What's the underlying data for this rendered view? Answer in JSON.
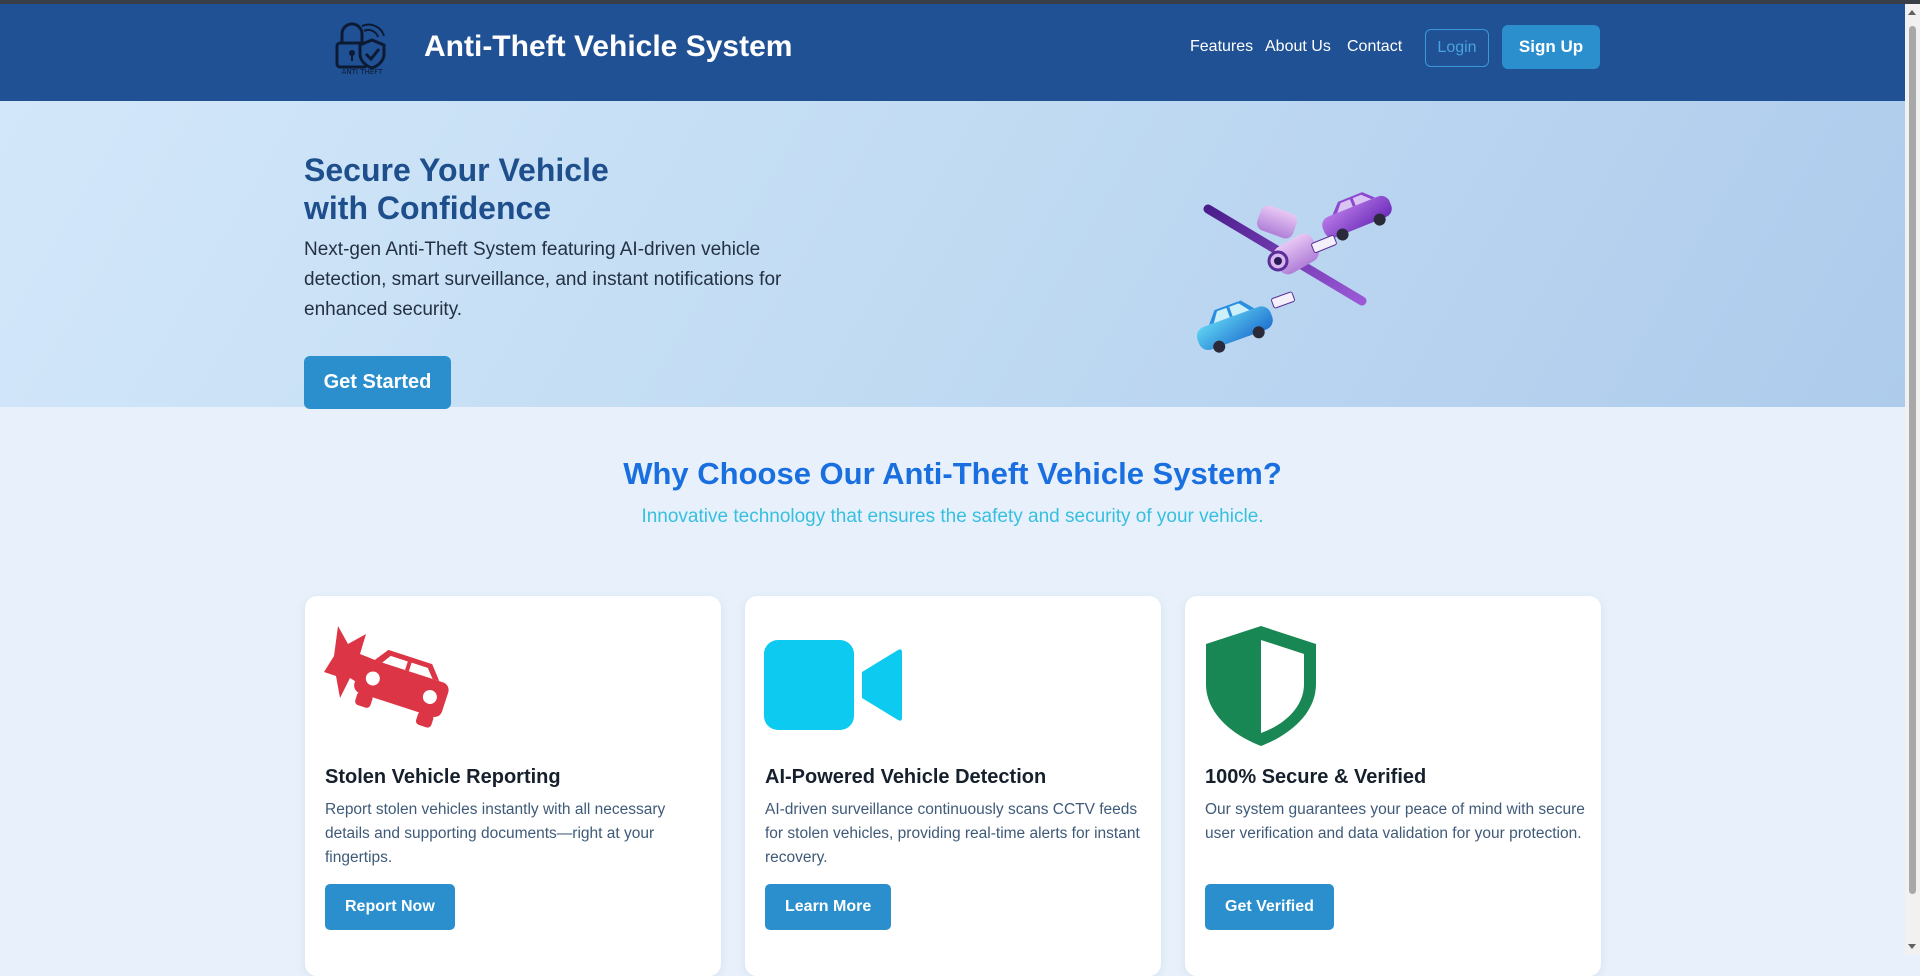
{
  "navbar": {
    "logo_icon": "lock-shield-icon",
    "logo_caption": "ANTI THEFT",
    "brand": "Anti-Theft Vehicle System",
    "links": [
      "Features",
      "About Us",
      "Contact"
    ],
    "login_label": "Login",
    "signup_label": "Sign Up"
  },
  "hero": {
    "title_line1": "Secure Your Vehicle",
    "title_line2": "with Confidence",
    "description": "Next-gen Anti-Theft System featuring AI-driven vehicle detection, smart surveillance, and instant notifications for enhanced security.",
    "cta_label": "Get Started",
    "illustration": "cctv-camera-with-cars-illustration"
  },
  "features": {
    "title": "Why Choose Our Anti-Theft Vehicle System?",
    "subtitle": "Innovative technology that ensures the safety and security of your vehicle.",
    "cards": [
      {
        "icon": "car-crash-icon",
        "icon_color": "#dc3545",
        "title": "Stolen Vehicle Reporting",
        "description": "Report stolen vehicles instantly with all necessary details and supporting documents—right at your fingertips.",
        "button": "Report Now"
      },
      {
        "icon": "video-camera-icon",
        "icon_color": "#0dcaf0",
        "title": "AI-Powered Vehicle Detection",
        "description": "AI-driven surveillance continuously scans CCTV feeds for stolen vehicles, providing real-time alerts for instant recovery.",
        "button": "Learn More"
      },
      {
        "icon": "shield-half-icon",
        "icon_color": "#198754",
        "title": "100% Secure & Verified",
        "description": "Our system guarantees your peace of mind with secure user verification and data validation for your protection.",
        "button": "Get Verified"
      }
    ]
  },
  "colors": {
    "navbar_bg": "#1f5194",
    "primary_button": "#2b8fce",
    "section_title": "#1a6fe0",
    "section_subtitle": "#37bfe0"
  }
}
